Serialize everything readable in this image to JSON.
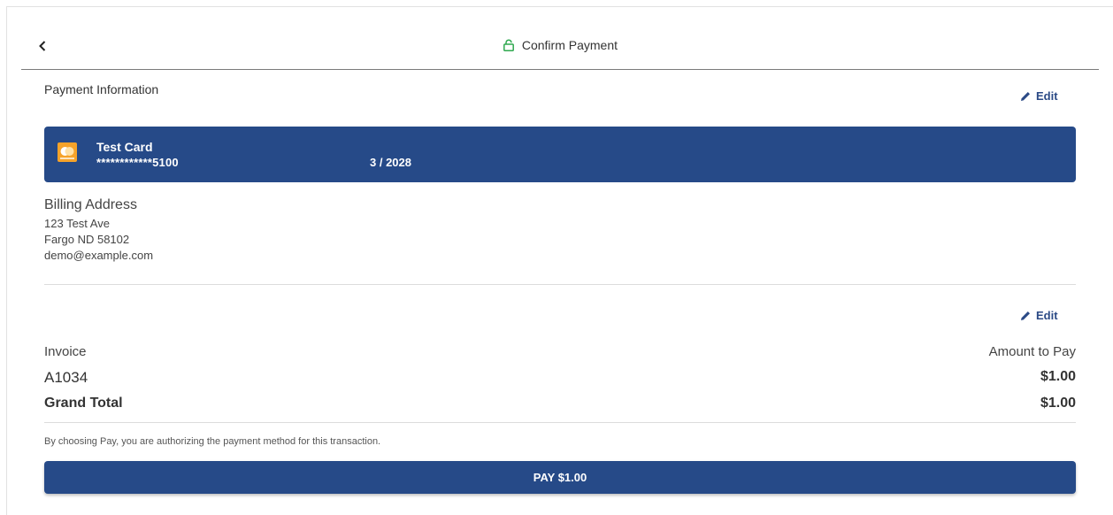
{
  "header": {
    "title": "Confirm Payment",
    "back_icon": "chevron-left-icon",
    "lock_icon": "lock-icon"
  },
  "payment_info": {
    "label": "Payment Information",
    "edit_label": "Edit",
    "card": {
      "name": "Test Card",
      "number": "************5100",
      "expiry": "3 / 2028",
      "brand_icon": "mastercard-icon"
    }
  },
  "billing": {
    "heading": "Billing Address",
    "street": "123 Test Ave",
    "city_state_zip": "Fargo ND 58102",
    "email": "demo@example.com"
  },
  "invoice": {
    "edit_label": "Edit",
    "col_invoice": "Invoice",
    "col_amount": "Amount to Pay",
    "invoice_id": "A1034",
    "invoice_amount": "$1.00",
    "grand_total_label": "Grand Total",
    "grand_total_value": "$1.00"
  },
  "disclaimer": "By choosing Pay, you are authorizing the payment method for this transaction.",
  "pay_button_label": "PAY $1.00",
  "colors": {
    "primary": "#264a88",
    "lock_green": "#2fa84f",
    "card_logo": "#f6a32a"
  }
}
